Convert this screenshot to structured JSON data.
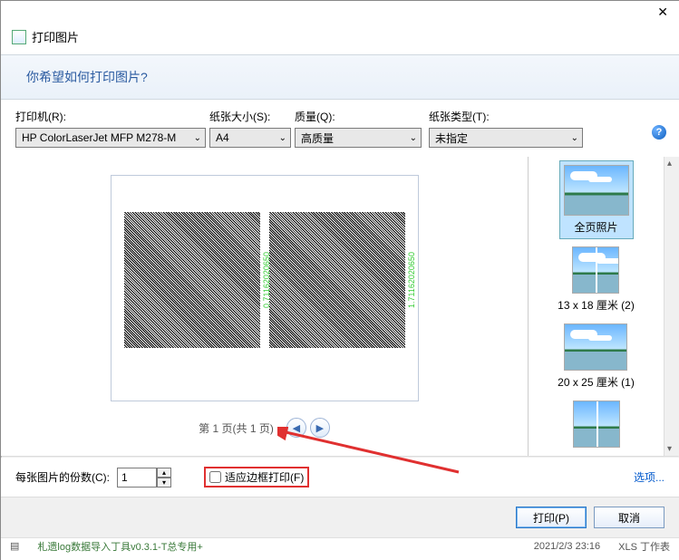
{
  "title": "打印图片",
  "banner": "你希望如何打印图片?",
  "labels": {
    "printer": "打印机(R):",
    "paper_size": "纸张大小(S):",
    "quality": "质量(Q):",
    "paper_type": "纸张类型(T):",
    "copies": "每张图片的份数(C):",
    "fit_frame": "适应边框打印(F)",
    "options": "选项...",
    "print": "打印(P)",
    "cancel": "取消"
  },
  "values": {
    "printer": "HP ColorLaserJet MFP M278-M",
    "paper_size": "A4",
    "quality": "高质量",
    "paper_type": "未指定",
    "copies": "1",
    "fit_frame_checked": false
  },
  "pager": {
    "text": "第 1 页(共 1 页)"
  },
  "layouts": [
    {
      "label": "全页照片",
      "thumb": "full",
      "selected": true
    },
    {
      "label": "13 x 18 厘米 (2)",
      "thumb": "split",
      "selected": false
    },
    {
      "label": "20 x 25 厘米 (1)",
      "thumb": "land",
      "selected": false
    }
  ],
  "preview_stamps": [
    "0.71162020650",
    "1.71162020650"
  ],
  "statusbar": {
    "filename": "札遗log数据导入丁具v0.3.1-T总专用+",
    "date": "2021/2/3 23:16",
    "type": "XLS 丁作表"
  }
}
